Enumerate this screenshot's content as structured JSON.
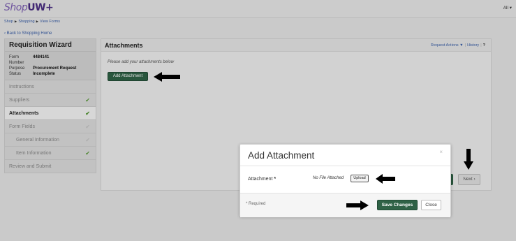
{
  "brand": {
    "shop": "Shop",
    "uw": "UW",
    "plus": "+"
  },
  "top_menu": {
    "all_label": "All ▾"
  },
  "breadcrumb": {
    "items": [
      "Shop",
      "Shopping",
      "View Forms"
    ],
    "separator": "▶"
  },
  "back_link": "‹ Back to Shopping Home",
  "sidebar": {
    "title": "Requisition Wizard",
    "meta": [
      {
        "key": "Form Number",
        "value": "4484141"
      },
      {
        "key": "Purpose",
        "value": "Procurement Request"
      },
      {
        "key": "Status",
        "value": "Incomplete"
      }
    ],
    "items": [
      {
        "label": "Instructions",
        "check": ""
      },
      {
        "label": "Suppliers",
        "check": "✔"
      },
      {
        "label": "Attachments",
        "check": "✔"
      },
      {
        "label": "Form Fields",
        "check": "✔"
      },
      {
        "label": "General Information",
        "check": "✔"
      },
      {
        "label": "Item Information",
        "check": "✔"
      },
      {
        "label": "Review and Submit",
        "check": ""
      }
    ]
  },
  "main": {
    "title": "Attachments",
    "request_actions": "Request Actions ▼",
    "history": "History",
    "help": "?",
    "hint": "Please add your attachments below",
    "add_attachment_label": "Add Attachment",
    "next_label": "Next ›"
  },
  "modal": {
    "title": "Add Attachment",
    "close_glyph": "×",
    "attachment_label": "Attachment",
    "required_star": "*",
    "no_file_text": "No File Attached",
    "upload_label": "Upload",
    "required_note": "* Required",
    "save_label": "Save Changes",
    "close_label": "Close"
  },
  "colors": {
    "accent_green": "#2f6246",
    "brand_purple": "#4b2e83",
    "link_blue": "#3a5fa8",
    "check_green": "#5a9a3a"
  }
}
